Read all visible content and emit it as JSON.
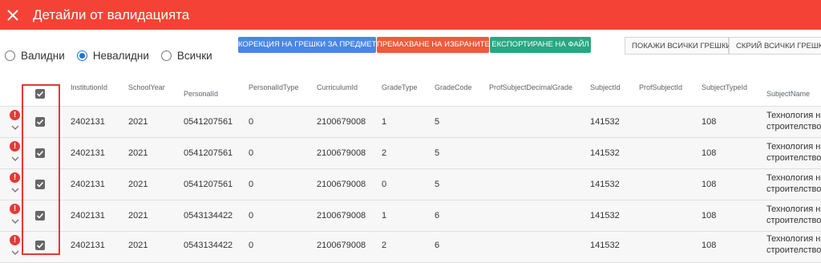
{
  "header": {
    "title": "Детайли от валидацията"
  },
  "filters": {
    "options": [
      {
        "label": "Валидни",
        "selected": false
      },
      {
        "label": "Невалидни",
        "selected": true
      },
      {
        "label": "Всички",
        "selected": false
      }
    ]
  },
  "toolbar": {
    "correct_label": "КОРЕКЦИЯ НА ГРЕШКИ ЗА ПРЕДМЕТ",
    "remove_label": "ПРЕМАХВАНЕ НА ИЗБРАНИТЕ",
    "export_label": "ЕКСПОРТИРАНЕ НА ФАЙЛ",
    "show_errors_label": "ПОКАЖИ ВСИЧКИ ГРЕШКИ",
    "hide_errors_label": "СКРИЙ ВСИЧКИ ГРЕШКИ"
  },
  "table": {
    "columns": [
      "InstitutionId",
      "SchoolYear",
      "PersonalId",
      "PersonalIdType",
      "CurriculumId",
      "GradeType",
      "GradeCode",
      "ProfSubjectDecimalGrade",
      "SubjectId",
      "ProfSubjectId",
      "SubjectTypeId",
      "SubjectName"
    ],
    "rows": [
      {
        "institution_id": "2402131",
        "school_year": "2021",
        "personal_id": "0541207561",
        "personal_id_type": "0",
        "curriculum_id": "2100679008",
        "grade_type": "1",
        "grade_code": "5",
        "prof_subject_decimal_grade": "",
        "subject_id": "141532",
        "prof_subject_id": "",
        "subject_type_id": "108",
        "subject_name_line1": "Технология на",
        "subject_name_line2": "строителството"
      },
      {
        "institution_id": "2402131",
        "school_year": "2021",
        "personal_id": "0541207561",
        "personal_id_type": "0",
        "curriculum_id": "2100679008",
        "grade_type": "2",
        "grade_code": "5",
        "prof_subject_decimal_grade": "",
        "subject_id": "141532",
        "prof_subject_id": "",
        "subject_type_id": "108",
        "subject_name_line1": "Технология на",
        "subject_name_line2": "строителството"
      },
      {
        "institution_id": "2402131",
        "school_year": "2021",
        "personal_id": "0541207561",
        "personal_id_type": "0",
        "curriculum_id": "2100679008",
        "grade_type": "0",
        "grade_code": "5",
        "prof_subject_decimal_grade": "",
        "subject_id": "141532",
        "prof_subject_id": "",
        "subject_type_id": "108",
        "subject_name_line1": "Технология на",
        "subject_name_line2": "строителството"
      },
      {
        "institution_id": "2402131",
        "school_year": "2021",
        "personal_id": "0543134422",
        "personal_id_type": "0",
        "curriculum_id": "2100679008",
        "grade_type": "1",
        "grade_code": "6",
        "prof_subject_decimal_grade": "",
        "subject_id": "141532",
        "prof_subject_id": "",
        "subject_type_id": "108",
        "subject_name_line1": "Технология на",
        "subject_name_line2": "строителството"
      },
      {
        "institution_id": "2402131",
        "school_year": "2021",
        "personal_id": "0543134422",
        "personal_id_type": "0",
        "curriculum_id": "2100679008",
        "grade_type": "2",
        "grade_code": "6",
        "prof_subject_decimal_grade": "",
        "subject_id": "141532",
        "prof_subject_id": "",
        "subject_type_id": "108",
        "subject_name_line1": "Технология на",
        "subject_name_line2": "строителството"
      }
    ]
  },
  "colors": {
    "header_bg": "#f44336",
    "primary": "#1976d2",
    "error": "#e53935"
  }
}
